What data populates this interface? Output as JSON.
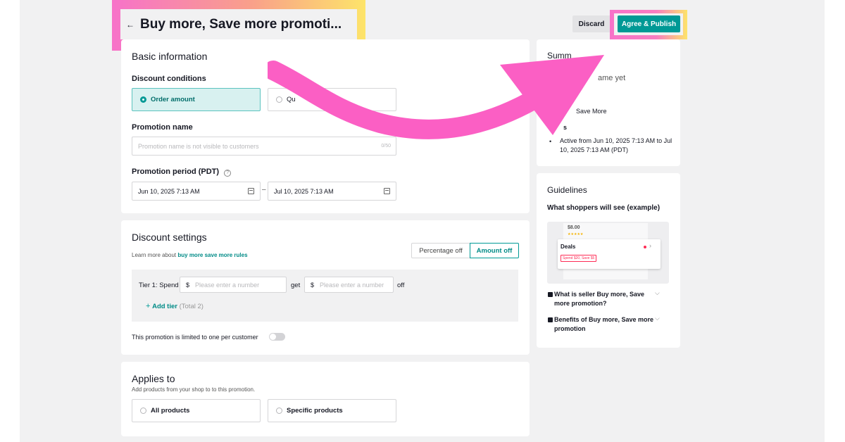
{
  "header": {
    "back_icon": "arrow-left-icon",
    "title": "Buy more, Save more promoti...",
    "discard_label": "Discard",
    "publish_label": "Agree & Publish"
  },
  "colors": {
    "accent": "#009995",
    "highlight_pink": "#f772c9",
    "highlight_yellow": "#fde46a",
    "arrow_pink": "#fb5fc4"
  },
  "basic": {
    "heading": "Basic information",
    "conditions_label": "Discount conditions",
    "condition_options": [
      "Order amount",
      "Qu"
    ],
    "selected_condition": "Order amount",
    "name_label": "Promotion name",
    "name_placeholder": "Promotion name is not visible to customers",
    "name_counter": "0/50",
    "period_label": "Promotion period (PDT)",
    "start_date": "Jun 10, 2025 7:13 AM",
    "period_separator": "–",
    "end_date": "Jul 10, 2025 7:13 AM"
  },
  "discount": {
    "heading": "Discount settings",
    "learn_prefix": "Learn more about ",
    "learn_link": "buy more save more rules",
    "mode_options": [
      "Percentage off",
      "Amount off"
    ],
    "selected_mode": "Amount off",
    "tier_label": "Tier 1: Spend",
    "currency": "$",
    "spend_placeholder": "Please enter a number",
    "get_label": "get",
    "get_placeholder": "Please enter a number",
    "off_label": "off",
    "add_tier_label": "Add tier",
    "add_tier_total": "(Total 2)",
    "limit_text": "This promotion is limited to one per customer",
    "limit_enabled": false
  },
  "applies": {
    "heading": "Applies to",
    "subtext": "Add products from your shop to to this promotion.",
    "options": [
      "All products",
      "Specific products"
    ]
  },
  "summary": {
    "heading_visible": "Summ",
    "name_status": "ame yet",
    "type_value": "Save More",
    "period_fragment": "s",
    "period_detail": "Active from Jun 10, 2025 7:13 AM to Jul 10, 2025 7:13 AM (PDT)"
  },
  "guidelines": {
    "heading": "Guidelines",
    "preview_label": "What shoppers will see (example)",
    "preview_price": "$8.00",
    "preview_deals": "Deals",
    "preview_badge": "Spend $20, Save $5",
    "faq": [
      "What is seller Buy more, Save more promotion?",
      "Benefits of Buy more, Save more promotion"
    ]
  }
}
